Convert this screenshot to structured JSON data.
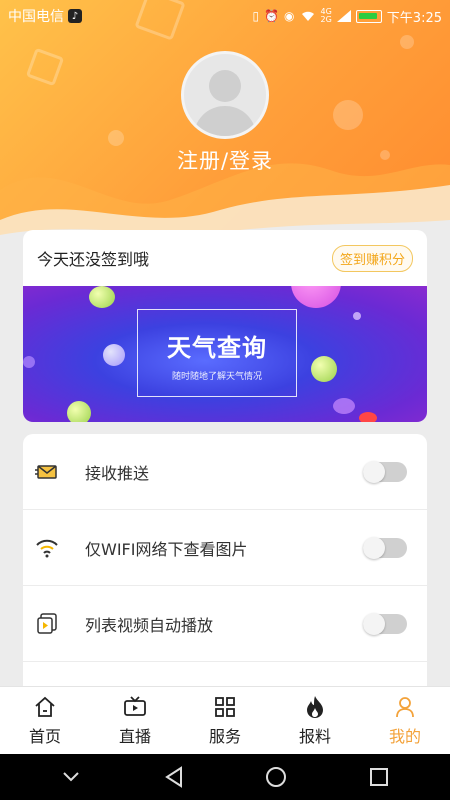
{
  "status_bar": {
    "carrier": "中国电信",
    "time": "下午3:25",
    "network": "4G",
    "network2": "2G"
  },
  "profile": {
    "login_label": "注册/登录"
  },
  "sign_in": {
    "message": "今天还没签到哦",
    "button": "签到赚积分"
  },
  "banner": {
    "title": "天气查询",
    "subtitle": "随时随地了解天气情况"
  },
  "settings": [
    {
      "label": "接收推送",
      "icon": "envelope-icon",
      "enabled": false
    },
    {
      "label": "仅WIFI网络下查看图片",
      "icon": "wifi-icon",
      "enabled": false
    },
    {
      "label": "列表视频自动播放",
      "icon": "video-play-icon",
      "enabled": false
    }
  ],
  "tabs": [
    {
      "label": "首页",
      "icon": "home-icon",
      "active": false
    },
    {
      "label": "直播",
      "icon": "tv-icon",
      "active": false
    },
    {
      "label": "服务",
      "icon": "grid-icon",
      "active": false
    },
    {
      "label": "报料",
      "icon": "fire-icon",
      "active": false
    },
    {
      "label": "我的",
      "icon": "person-icon",
      "active": true
    }
  ],
  "colors": {
    "accent": "#f3a23a",
    "header_start": "#ffc24a",
    "header_end": "#ff8a2e"
  }
}
